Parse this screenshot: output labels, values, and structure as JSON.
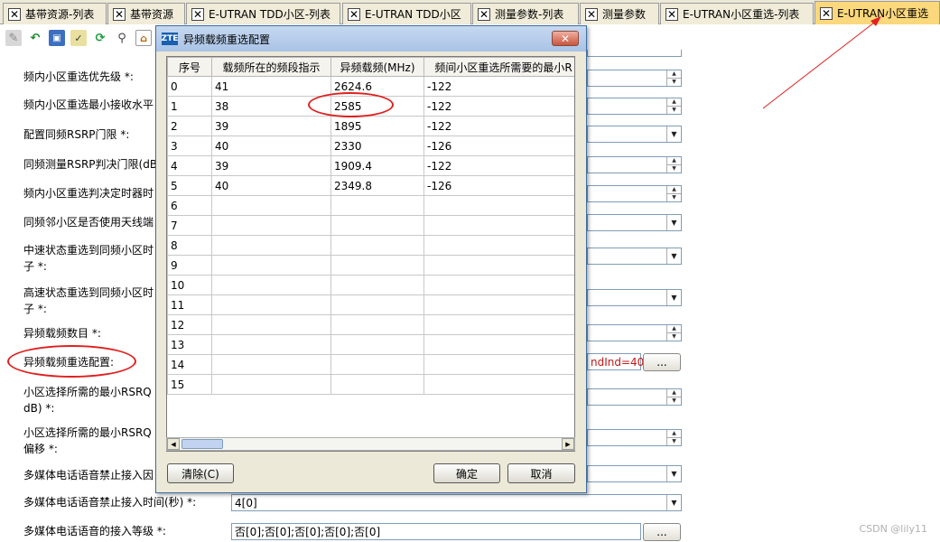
{
  "tabs": [
    {
      "label": "基带资源-列表",
      "active": false
    },
    {
      "label": "基带资源",
      "active": false
    },
    {
      "label": "E-UTRAN TDD小区-列表",
      "active": false
    },
    {
      "label": "E-UTRAN TDD小区",
      "active": false
    },
    {
      "label": "测量参数-列表",
      "active": false
    },
    {
      "label": "测量参数",
      "active": false
    },
    {
      "label": "E-UTRAN小区重选-列表",
      "active": false
    },
    {
      "label": "E-UTRAN小区重选",
      "active": true
    }
  ],
  "toolbar": {
    "icons": [
      "edit-icon",
      "undo-icon",
      "save-icon",
      "check-icon",
      "refresh-icon",
      "find-icon",
      "home-icon"
    ]
  },
  "form": {
    "fields": [
      {
        "label": "频内小区重选优先级 *:",
        "control": "spin",
        "value": ""
      },
      {
        "label": "频内小区重选最小接收水平",
        "control": "spin",
        "value": ""
      },
      {
        "label": "配置同频RSRP门限 *:",
        "control": "dropdown",
        "value": ""
      },
      {
        "label": "同频测量RSRP判决门限(dB",
        "control": "spin",
        "value": ""
      },
      {
        "label": "频内小区重选判决定时器时",
        "control": "spin",
        "value": ""
      },
      {
        "label": "同频邻小区是否使用天线端",
        "control": "dropdown",
        "value": ""
      },
      {
        "label": "中速状态重选到同频小区时",
        "label2": "子 *:",
        "control": "dropdown",
        "value": ""
      },
      {
        "label": "高速状态重选到同频小区时",
        "label2": "子 *:",
        "control": "dropdown",
        "value": ""
      },
      {
        "label": "异频载频数目 *:",
        "control": "spin",
        "value": ""
      },
      {
        "label": "异频载频重选配置:",
        "control": "text-button",
        "value": "ndInd=40}]",
        "button": "..."
      },
      {
        "label": "小区选择所需的最小RSRQ",
        "label2": "dB) *:",
        "control": "spin",
        "value": ""
      },
      {
        "label": "小区选择所需的最小RSRQ",
        "label2": "偏移 *:",
        "control": "spin",
        "value": ""
      },
      {
        "label": "多媒体电话语音禁止接入因",
        "control": "dropdown",
        "value": ""
      },
      {
        "label": "多媒体电话语音禁止接入时间(秒) *:",
        "control": "dropdown",
        "value": "4[0]"
      },
      {
        "label": "多媒体电话语音的接入等级 *:",
        "control": "text-button",
        "value": "否[0];否[0];否[0];否[0];否[0]",
        "button": "..."
      }
    ]
  },
  "dialog": {
    "title": "异频载频重选配置",
    "logo": "ZTE",
    "close": "✕",
    "columns": [
      "序号",
      "载频所在的频段指示",
      "异频载频(MHz)",
      "频间小区重选所需要的最小R"
    ],
    "rows": [
      [
        "0",
        "41",
        "2624.6",
        "-122"
      ],
      [
        "1",
        "38",
        "2585",
        "-122"
      ],
      [
        "2",
        "39",
        "1895",
        "-122"
      ],
      [
        "3",
        "40",
        "2330",
        "-126"
      ],
      [
        "4",
        "39",
        "1909.4",
        "-122"
      ],
      [
        "5",
        "40",
        "2349.8",
        "-126"
      ],
      [
        "6",
        "",
        "",
        ""
      ],
      [
        "7",
        "",
        "",
        ""
      ],
      [
        "8",
        "",
        "",
        ""
      ],
      [
        "9",
        "",
        "",
        ""
      ],
      [
        "10",
        "",
        "",
        ""
      ],
      [
        "11",
        "",
        "",
        ""
      ],
      [
        "12",
        "",
        "",
        ""
      ],
      [
        "13",
        "",
        "",
        ""
      ],
      [
        "14",
        "",
        "",
        ""
      ],
      [
        "15",
        "",
        "",
        ""
      ]
    ],
    "buttons": {
      "clear": "清除(C)",
      "ok": "确定",
      "cancel": "取消"
    }
  },
  "watermark": "CSDN @lily11",
  "colors": {
    "annotation": "#e02020",
    "active_tab": "#fbd87c",
    "dialog_border": "#3b6ea5"
  }
}
